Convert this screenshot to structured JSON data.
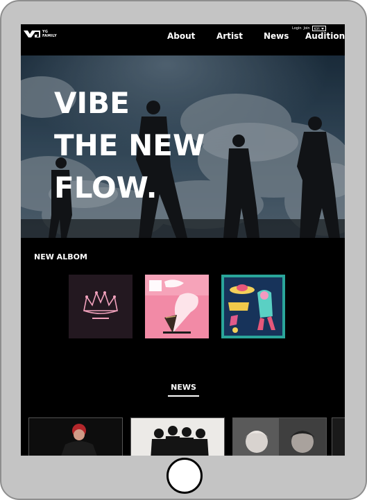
{
  "header": {
    "logo_line1": "YG",
    "logo_line2": "FAMILY",
    "nav": [
      "About",
      "Artist",
      "News",
      "Audition"
    ],
    "login_label": "Login",
    "join_label": "Join",
    "language": "KOR"
  },
  "hero": {
    "lines": [
      "VIBE",
      "THE NEW",
      "FLOW."
    ]
  },
  "album_section": {
    "title": "NEW ALBOM",
    "albums": [
      "blackpink-album-cover",
      "ice-cream-single-cover",
      "alien-single-cover"
    ]
  },
  "news_section": {
    "title": "NEWS"
  },
  "colors": {
    "background": "#000000",
    "text": "#ffffff",
    "device_frame": "#c4c4c4"
  }
}
